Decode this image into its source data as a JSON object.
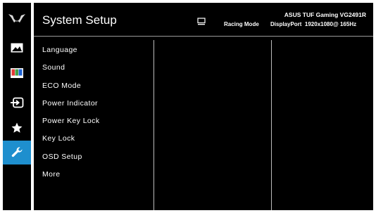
{
  "header": {
    "title": "System Setup",
    "model": "ASUS TUF Gaming  VG2491R",
    "mode": "Racing Mode",
    "signal": "DisplayPort  1920x1080@ 165Hz"
  },
  "sidebar": {
    "icons": [
      "tuf-logo-icon",
      "image-icon",
      "color-icon",
      "input-select-icon",
      "star-icon",
      "wrench-icon"
    ],
    "active_index": 5
  },
  "menu": {
    "items": [
      {
        "label": "Language"
      },
      {
        "label": "Sound"
      },
      {
        "label": "ECO Mode"
      },
      {
        "label": "Power Indicator"
      },
      {
        "label": "Power Key Lock"
      },
      {
        "label": "Key Lock"
      },
      {
        "label": "OSD Setup"
      },
      {
        "label": "More"
      }
    ]
  },
  "colors": {
    "active": "#1e8fce",
    "background": "#000000",
    "text": "#ffffff"
  }
}
